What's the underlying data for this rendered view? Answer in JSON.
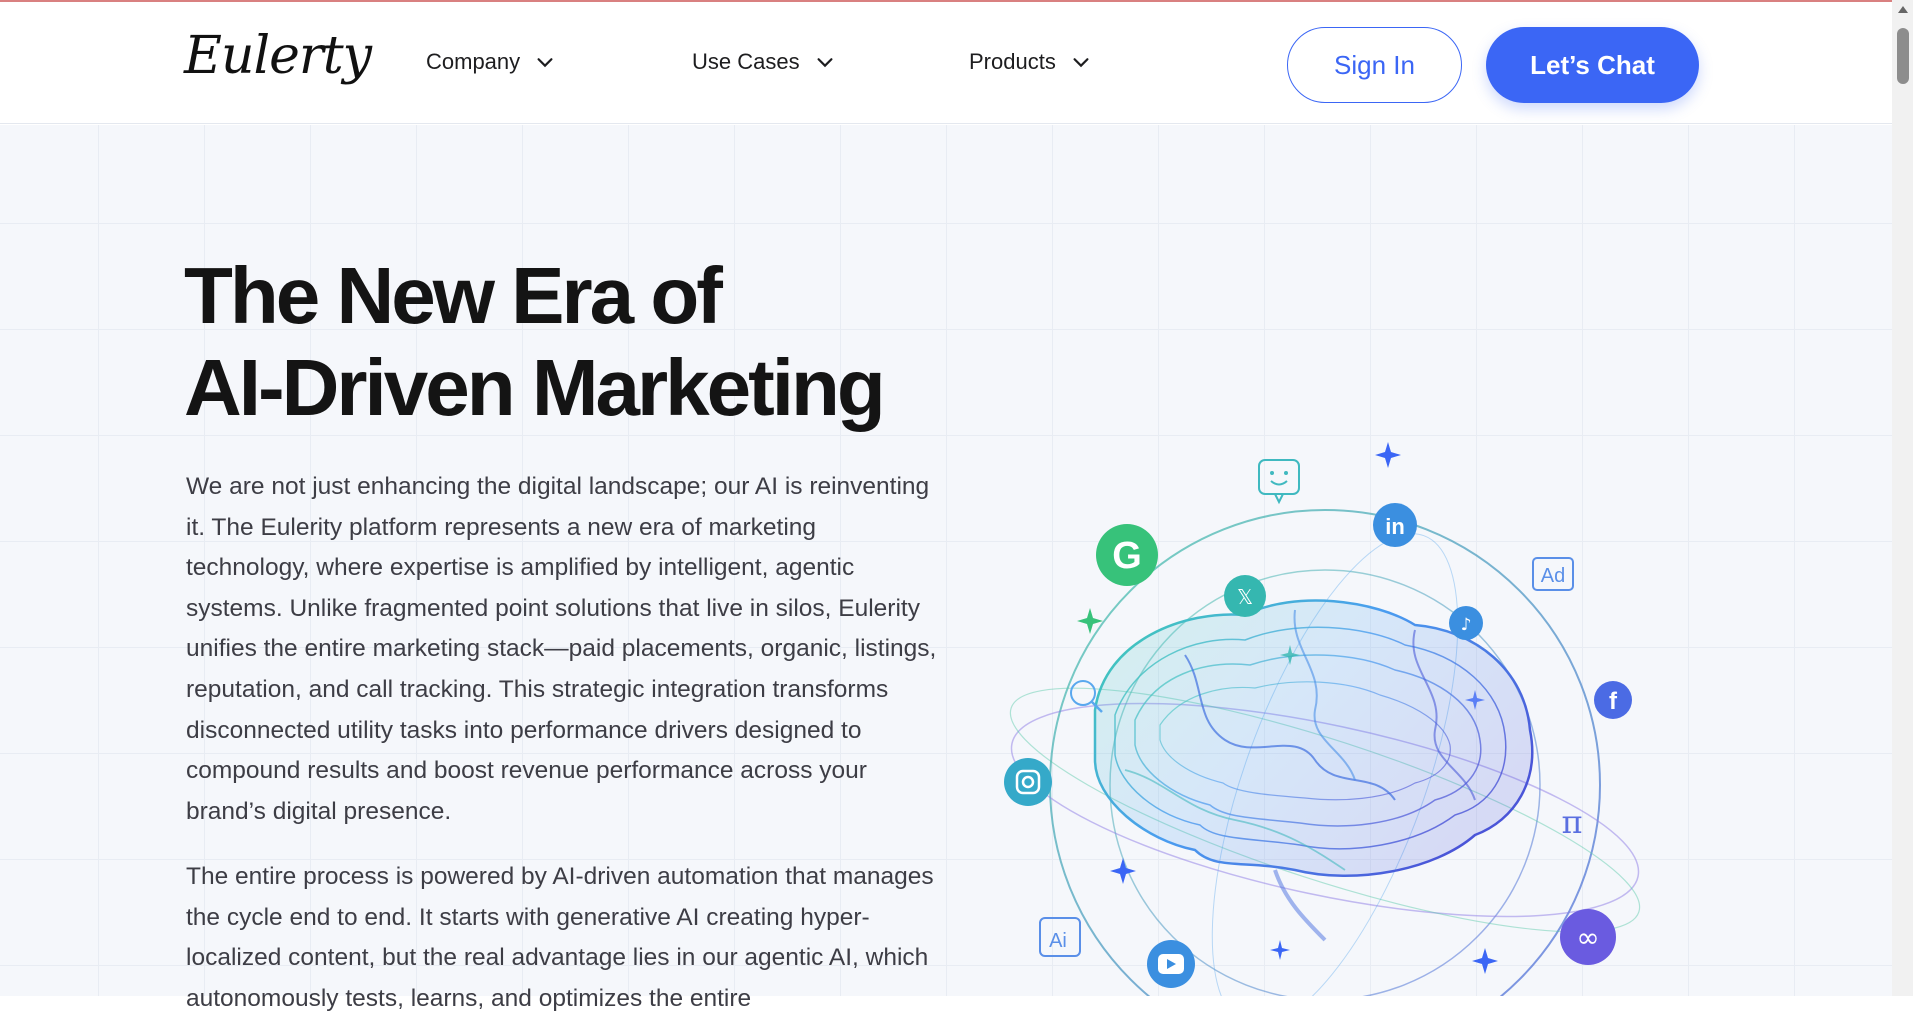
{
  "header": {
    "logo": "Eulerty",
    "nav": [
      {
        "label": "Company"
      },
      {
        "label": "Use Cases"
      },
      {
        "label": "Products"
      }
    ],
    "sign_in": "Sign In",
    "chat": "Let’s Chat"
  },
  "hero": {
    "title_line1": "The New Era of",
    "title_line2": "AI-Driven Marketing",
    "paragraph1": "We are not just enhancing the digital landscape; our AI is reinventing it. The Eulerity platform represents a new era of marketing technology, where expertise is amplified by intelligent, agentic systems. Unlike fragmented point solutions that live in silos, Eulerity unifies the entire marketing stack—paid placements, organic, listings, reputation, and call tracking. This strategic integration transforms disconnected utility tasks into performance drivers designed to compound results and boost revenue performance across your brand’s digital presence.",
    "paragraph2": "The entire process is powered by AI-driven automation that manages the cycle end to end. It starts with generative AI creating hyper-localized content, but the real advantage lies in our agentic AI, which autonomously tests, learns, and optimizes the entire"
  },
  "illustration": {
    "icons": [
      "google-icon",
      "linkedin-icon",
      "x-icon",
      "tiktok-icon",
      "facebook-icon",
      "instagram-icon",
      "youtube-icon",
      "meta-icon",
      "ad-icon",
      "ai-icon",
      "chat-smiley-icon",
      "search-icon",
      "pi-icon"
    ],
    "ad_text": "Ad",
    "ai_text": "Ai",
    "colors": {
      "green": "#37c27a",
      "blue": "#3b8fe0",
      "teal": "#35b7b0",
      "purple": "#6a5be0",
      "accent": "#3b66f5"
    }
  }
}
